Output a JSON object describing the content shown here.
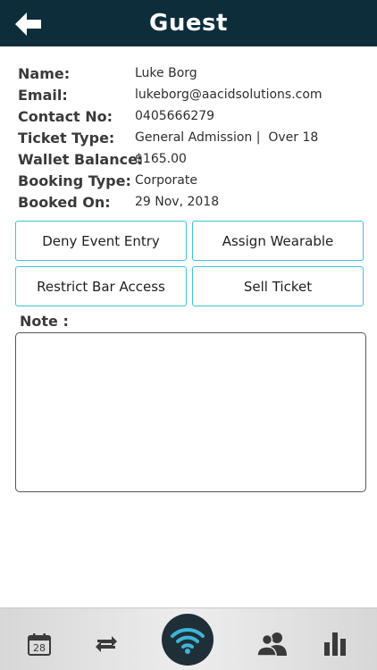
{
  "header": {
    "title": "Guest",
    "back_icon": "back-arrow-icon",
    "background": "#0e2d3b"
  },
  "guest": {
    "name_label": "Name:",
    "name_value": "Luke Borg",
    "email_label": "Email:",
    "email_value": "lukeborg@aacidsolutions.com",
    "contact_label": "Contact No:",
    "contact_value": "0405666279",
    "ticket_label": "Ticket Type:",
    "ticket_value": "General Admission |  Over 18",
    "wallet_label": "Wallet Balance:",
    "wallet_value": "$165.00",
    "booking_label": "Booking Type:",
    "booking_value": "Corporate",
    "booked_label": "Booked On:",
    "booked_value": "29 Nov, 2018"
  },
  "actions": {
    "deny_label": "Deny Event Entry",
    "assign_label": "Assign Wearable",
    "restrict_label": "Restrict Bar Access",
    "sell_label": "Sell Ticket",
    "border_color": "#3cc3d3"
  },
  "note": {
    "label": "Note :",
    "value": ""
  },
  "tabbar": {
    "calendar_day": "28",
    "icons": [
      "calendar-icon",
      "sync-icon",
      "wifi-icon",
      "users-icon",
      "bar-chart-icon"
    ]
  }
}
